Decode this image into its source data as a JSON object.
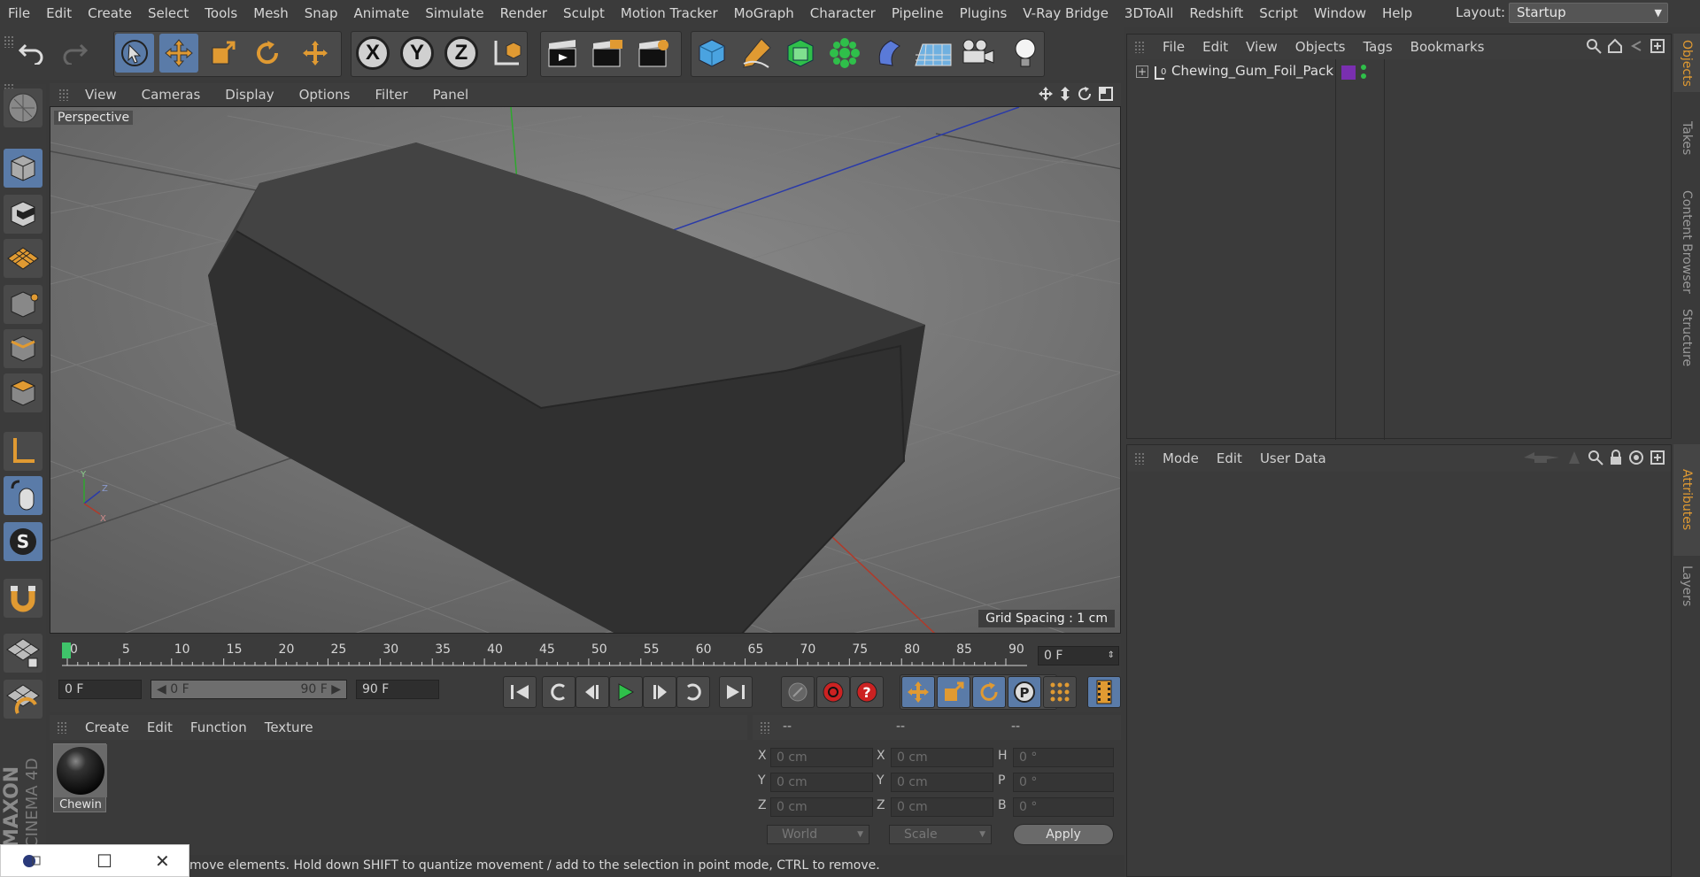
{
  "menu": [
    "File",
    "Edit",
    "Create",
    "Select",
    "Tools",
    "Mesh",
    "Snap",
    "Animate",
    "Simulate",
    "Render",
    "Sculpt",
    "Motion Tracker",
    "MoGraph",
    "Character",
    "Pipeline",
    "Plugins",
    "V-Ray Bridge",
    "3DToAll",
    "Redshift",
    "Script",
    "Window",
    "Help"
  ],
  "layout": {
    "label": "Layout:",
    "value": "Startup"
  },
  "axis_buttons": {
    "x": "X",
    "y": "Y",
    "z": "Z"
  },
  "viewport": {
    "menu": [
      "View",
      "Cameras",
      "Display",
      "Options",
      "Filter",
      "Panel"
    ],
    "label": "Perspective",
    "grid_spacing": "Grid Spacing : 1 cm",
    "axis_x": "X",
    "axis_y": "Y",
    "axis_z": "Z"
  },
  "timeline": {
    "ticks": [
      "0",
      "5",
      "10",
      "15",
      "20",
      "25",
      "30",
      "35",
      "40",
      "45",
      "50",
      "55",
      "60",
      "65",
      "70",
      "75",
      "80",
      "85",
      "90"
    ],
    "current_frame": "0 F"
  },
  "transport": {
    "start": "0 F",
    "range_start": "0 F",
    "range_end": "90 F",
    "end": "90 F"
  },
  "material_manager": {
    "menu": [
      "Create",
      "Edit",
      "Function",
      "Texture"
    ],
    "material_name": "Chewin"
  },
  "coordinates": {
    "headers": [
      "--",
      "--",
      "--"
    ],
    "pos": {
      "x": "0 cm",
      "y": "0 cm",
      "z": "0 cm"
    },
    "size": {
      "x": "0 cm",
      "y": "0 cm",
      "z": "0 cm"
    },
    "rot": {
      "h": "0 °",
      "p": "0 °",
      "b": "0 °"
    },
    "row_labels": [
      "X",
      "Y",
      "Z"
    ],
    "rot_labels": [
      "H",
      "P",
      "B"
    ],
    "space": "World",
    "mode": "Scale",
    "apply": "Apply"
  },
  "objects": {
    "menu": [
      "File",
      "Edit",
      "View",
      "Objects",
      "Tags",
      "Bookmarks"
    ],
    "items": [
      {
        "name": "Chewing_Gum_Foil_Pack",
        "layer_color": "#7a2fb0"
      }
    ]
  },
  "attributes": {
    "menu": [
      "Mode",
      "Edit",
      "User Data"
    ]
  },
  "side_tabs": [
    "Objects",
    "Takes",
    "Content Browser",
    "Structure",
    "Attributes",
    "Layers"
  ],
  "status": "move elements. Hold down SHIFT to quantize movement / add to the selection in point mode, CTRL to remove.",
  "logo": {
    "brand": "MAXON",
    "product": "CINEMA 4D"
  },
  "colors": {
    "accent_orange": "#e09a32",
    "active_blue": "#5a7ba8",
    "play_green": "#2fbf4a"
  }
}
